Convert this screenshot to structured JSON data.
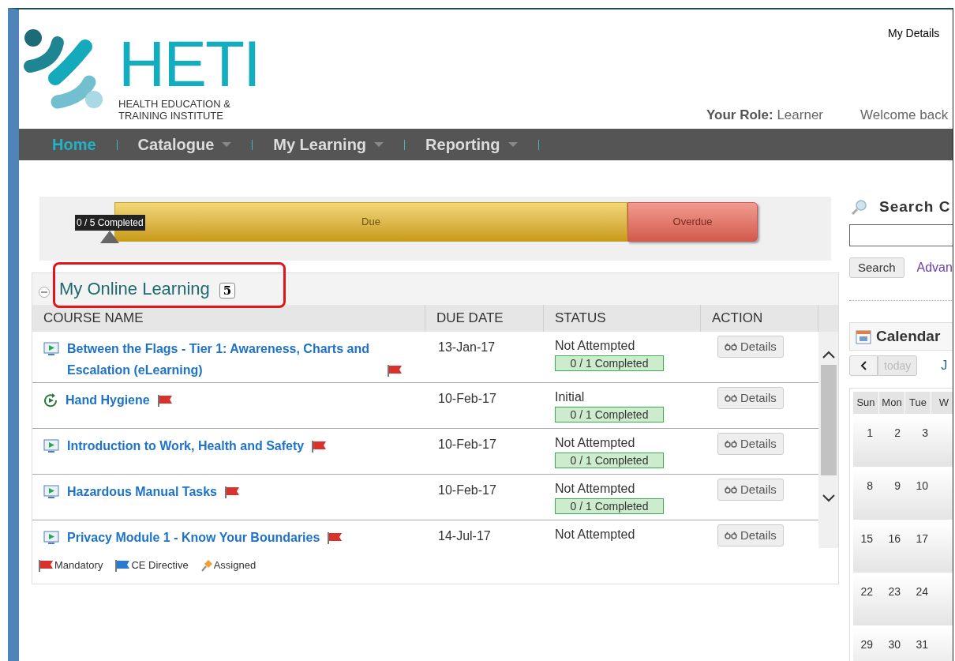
{
  "header": {
    "logo": {
      "title": "HETI",
      "subtitle_lines": [
        "HEALTH EDUCATION &",
        "TRAINING INSTITUTE"
      ]
    },
    "my_details": "My Details",
    "role_label": "Your Role:",
    "role_value": "Learner",
    "welcome": "Welcome back"
  },
  "nav": [
    {
      "label": "Home",
      "selected": true,
      "dropdown": false
    },
    {
      "label": "Catalogue",
      "selected": false,
      "dropdown": true
    },
    {
      "label": "My Learning",
      "selected": false,
      "dropdown": true
    },
    {
      "label": "Reporting",
      "selected": false,
      "dropdown": true
    }
  ],
  "progress": {
    "marker_label": "0 / 5 Completed",
    "level": 0,
    "segments": [
      {
        "label": "Due",
        "kind": "due"
      },
      {
        "label": "Overdue",
        "kind": "overdue"
      }
    ]
  },
  "panel": {
    "title": "My Online Learning",
    "count": "5",
    "expanded": true,
    "columns": [
      "COURSE NAME",
      "DUE DATE",
      "STATUS",
      "ACTION"
    ],
    "rows": [
      {
        "kind": "screen",
        "course": "Between the Flags - Tier 1: Awareness, Charts and Escalation (eLearning)",
        "mandatory": true,
        "due": "13-Jan-17",
        "status": "Not Attempted",
        "completion": "0 / 1 Completed",
        "action": "Details"
      },
      {
        "kind": "cycle",
        "course": "Hand Hygiene",
        "mandatory": true,
        "due": "10-Feb-17",
        "status": "Initial",
        "completion": "0 / 1 Completed",
        "action": "Details"
      },
      {
        "kind": "screen",
        "course": "Introduction to Work, Health and Safety",
        "mandatory": true,
        "due": "10-Feb-17",
        "status": "Not Attempted",
        "completion": "0 / 1 Completed",
        "action": "Details"
      },
      {
        "kind": "screen",
        "course": "Hazardous Manual Tasks",
        "mandatory": true,
        "due": "10-Feb-17",
        "status": "Not Attempted",
        "completion": "0 / 1 Completed",
        "action": "Details"
      },
      {
        "kind": "screen",
        "course": "Privacy Module 1 - Know Your Boundaries",
        "mandatory": true,
        "due": "14-Jul-17",
        "status": "Not Attempted",
        "action": "Details"
      }
    ],
    "legend": [
      {
        "kind": "red-flag",
        "label": "Mandatory"
      },
      {
        "kind": "blue-flag",
        "label": "CE Directive"
      },
      {
        "kind": "pin",
        "label": "Assigned"
      }
    ]
  },
  "sidebar": {
    "search_title": "Search C",
    "search_button": "Search",
    "advanced_link": "Advan",
    "calendar": {
      "title": "Calendar",
      "today_button": "today",
      "today_disabled": true,
      "month_fragment": "J",
      "weekdays": [
        "Sun",
        "Mon",
        "Tue",
        "W"
      ],
      "weeks": [
        [
          "1",
          "2",
          "3"
        ],
        [
          "8",
          "9",
          "10"
        ],
        [
          "15",
          "16",
          "17"
        ],
        [
          "22",
          "23",
          "24"
        ],
        [
          "29",
          "30",
          "31"
        ]
      ]
    }
  }
}
